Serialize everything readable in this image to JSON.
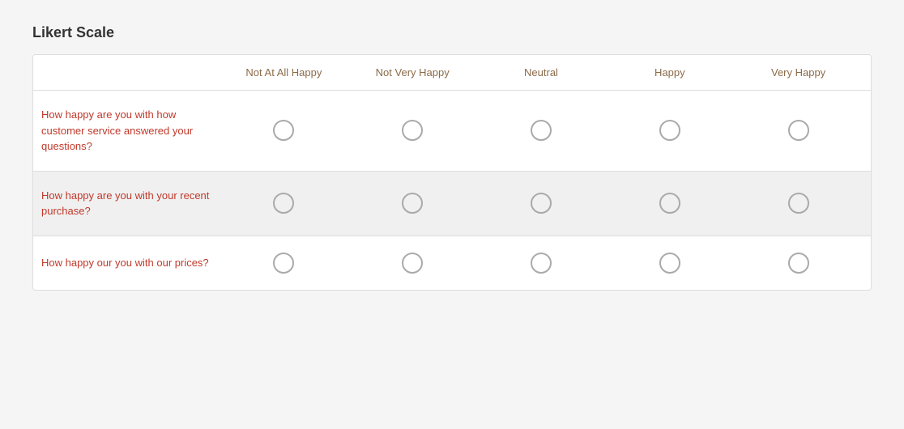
{
  "title": "Likert Scale",
  "columns": [
    {
      "id": "not-at-all-happy",
      "label": "Not At All Happy"
    },
    {
      "id": "not-very-happy",
      "label": "Not Very Happy"
    },
    {
      "id": "neutral",
      "label": "Neutral"
    },
    {
      "id": "happy",
      "label": "Happy"
    },
    {
      "id": "very-happy",
      "label": "Very Happy"
    }
  ],
  "rows": [
    {
      "id": "row-1",
      "question": "How happy are you with how customer service answered your questions?"
    },
    {
      "id": "row-2",
      "question": "How happy are you with your recent purchase?"
    },
    {
      "id": "row-3",
      "question": "How happy our you with our prices?"
    }
  ]
}
